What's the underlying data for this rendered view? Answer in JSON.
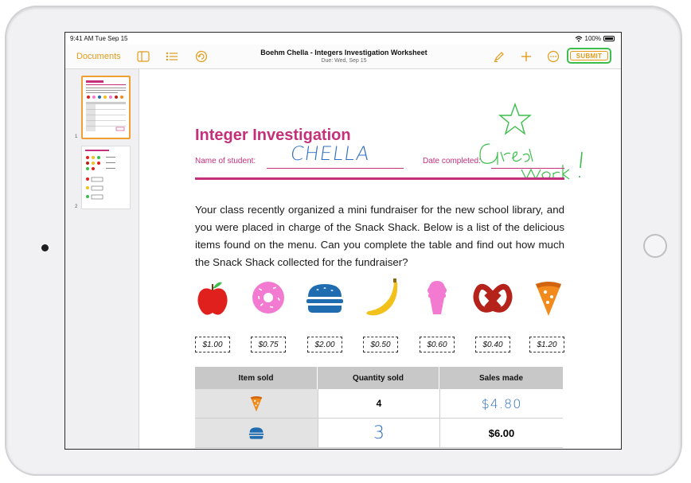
{
  "status": {
    "time": "9:41 AM  Tue Sep 15",
    "battery": "100%"
  },
  "toolbar": {
    "documents_label": "Documents",
    "title": "Boehm Chella - Integers Investigation Worksheet",
    "subtitle": "Due: Wed, Sep 15",
    "submit_label": "SUBMIT",
    "icons": [
      "sidebar-toggle-icon",
      "list-icon",
      "undo-icon",
      "markup-pen-icon",
      "add-icon",
      "more-icon"
    ]
  },
  "sidebar": {
    "pages": [
      {
        "number": "1",
        "selected": true
      },
      {
        "number": "2",
        "selected": false
      }
    ]
  },
  "worksheet": {
    "title": "Integer Investigation",
    "name_label": "Name of student:",
    "name_value": "CHELLA",
    "date_label": "Date completed:",
    "paragraph": "Your class recently organized a mini fundraiser for the new school library, and you were placed in charge of the Snack Shack. Below is a list of the delicious items found on the menu. Can you complete the table and find out how much the Snack Shack collected for the fundraiser?",
    "annotation": "Great Work!",
    "items": [
      {
        "name": "apple-icon",
        "price": "$1.00",
        "color": "#e0201d"
      },
      {
        "name": "donut-icon",
        "price": "$0.75",
        "color": "#f27ad0"
      },
      {
        "name": "burger-icon",
        "price": "$2.00",
        "color": "#1f6db0"
      },
      {
        "name": "banana-icon",
        "price": "$0.50",
        "color": "#f2c11b"
      },
      {
        "name": "ice-cream-icon",
        "price": "$0.60",
        "color": "#f27ad0"
      },
      {
        "name": "pretzel-icon",
        "price": "$0.40",
        "color": "#b5221a"
      },
      {
        "name": "pizza-icon",
        "price": "$1.20",
        "color": "#f28b1b"
      }
    ],
    "table": {
      "headers": [
        "Item sold",
        "Quantity sold",
        "Sales made"
      ],
      "rows": [
        {
          "icon": "pizza-icon",
          "quantity": "4",
          "sales": "$4.80"
        },
        {
          "icon": "burger-icon",
          "quantity": "3",
          "sales": "$6.00"
        }
      ]
    }
  },
  "colors": {
    "accent": "#e49b1a",
    "worksheet_pink": "#c4307a",
    "submit_outline": "#3dbd4c",
    "ink_green": "#3dbd4c",
    "ink_blue": "#2f6fc0"
  }
}
